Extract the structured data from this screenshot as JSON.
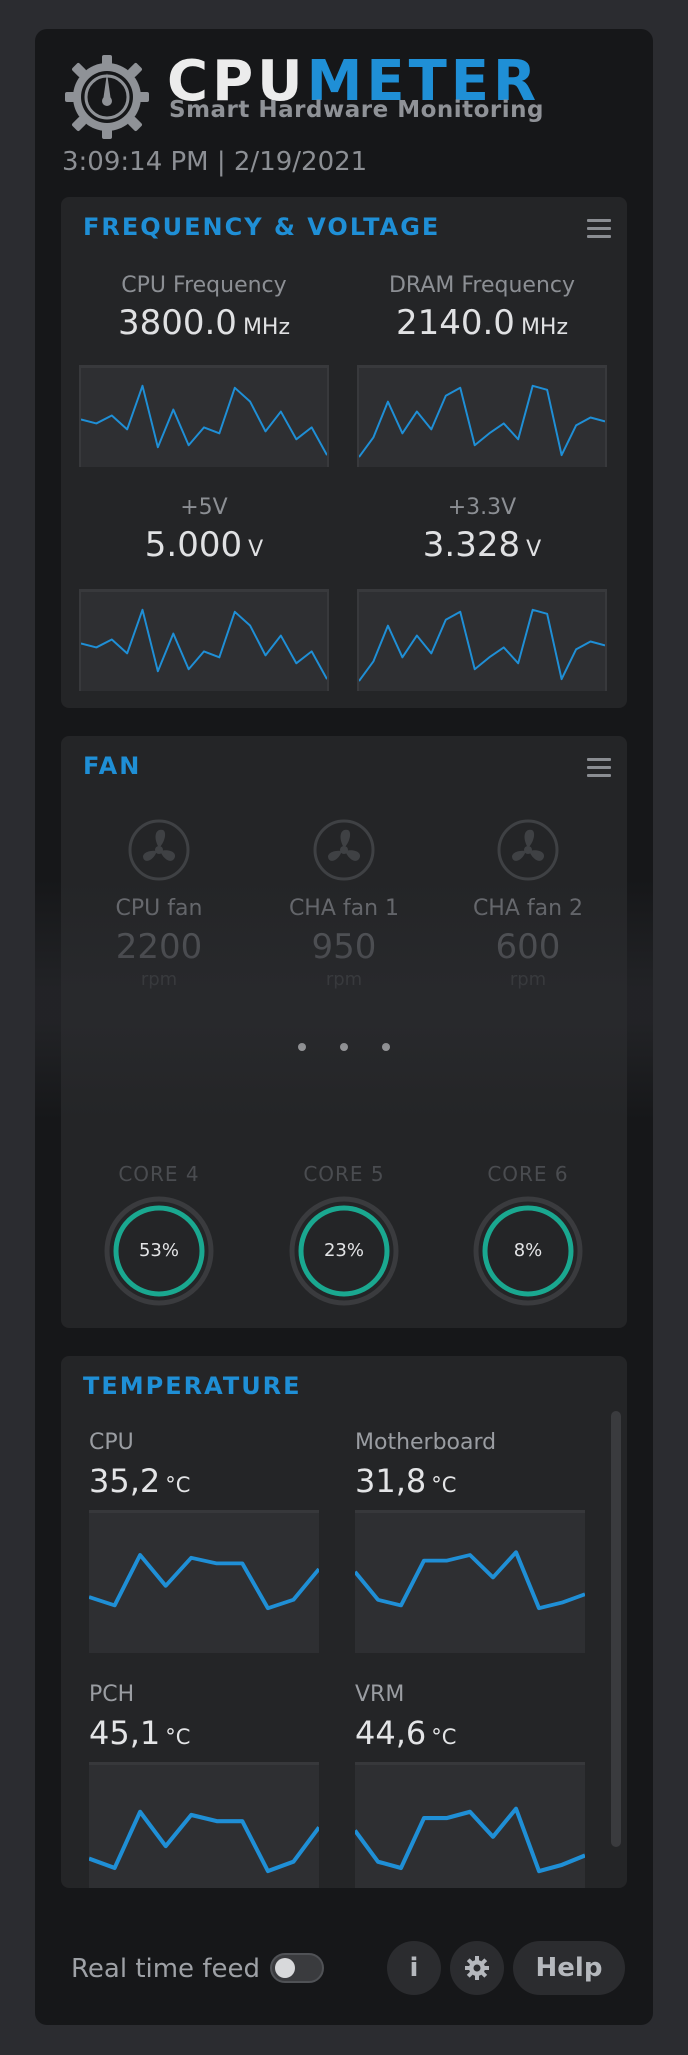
{
  "header": {
    "brand_part1": "CPU",
    "brand_part2": "METER",
    "subtitle": "Smart Hardware Monitoring",
    "datetime": "3:09:14 PM | 2/19/2021",
    "logo_icon": "gauge-gear-icon"
  },
  "colors": {
    "accent": "#1f8fd6",
    "teal_ring": "#1aa890",
    "panel_bg": "#242527",
    "app_bg": "#161719"
  },
  "frequency_voltage": {
    "title": "FREQUENCY & VOLTAGE",
    "metrics": [
      {
        "label": "CPU Frequency",
        "value": "3800.0",
        "unit": "MHz"
      },
      {
        "label": "DRAM Frequency",
        "value": "2140.0",
        "unit": "MHz"
      },
      {
        "label": "+5V",
        "value": "5.000",
        "unit": "V"
      },
      {
        "label": "+3.3V",
        "value": "3.328",
        "unit": "V"
      }
    ],
    "sparkline_a": [
      0.52,
      0.56,
      0.48,
      0.62,
      0.18,
      0.8,
      0.42,
      0.78,
      0.6,
      0.66,
      0.2,
      0.34,
      0.64,
      0.44,
      0.72,
      0.6,
      0.88
    ],
    "sparkline_b": [
      0.9,
      0.7,
      0.34,
      0.66,
      0.44,
      0.62,
      0.28,
      0.2,
      0.78,
      0.66,
      0.56,
      0.72,
      0.18,
      0.22,
      0.88,
      0.58,
      0.5,
      0.54
    ]
  },
  "fan": {
    "title": "FAN",
    "fans": [
      {
        "label": "CPU fan",
        "value": "2200",
        "unit": "rpm"
      },
      {
        "label": "CHA fan 1",
        "value": "950",
        "unit": "rpm"
      },
      {
        "label": "CHA fan 2",
        "value": "600",
        "unit": "rpm"
      }
    ],
    "cores": [
      {
        "label": "CORE 4",
        "percent": 53,
        "text": "53%"
      },
      {
        "label": "CORE 5",
        "percent": 23,
        "text": "23%"
      },
      {
        "label": "CORE 6",
        "percent": 8,
        "text": "8%"
      }
    ]
  },
  "temperature": {
    "title": "TEMPERATURE",
    "sensors": [
      {
        "label": "CPU",
        "value": "35,2",
        "unit": "°C"
      },
      {
        "label": "Motherboard",
        "value": "31,8",
        "unit": "°C"
      },
      {
        "label": "PCH",
        "value": "45,1",
        "unit": "°C"
      },
      {
        "label": "VRM",
        "value": "44,6",
        "unit": "°C"
      }
    ],
    "series_a": [
      0.6,
      0.66,
      0.3,
      0.52,
      0.32,
      0.36,
      0.36,
      0.68,
      0.62,
      0.4
    ],
    "series_b": [
      0.42,
      0.62,
      0.66,
      0.34,
      0.34,
      0.3,
      0.46,
      0.28,
      0.68,
      0.64,
      0.58
    ]
  },
  "footer": {
    "realtime_label": "Real time feed",
    "realtime_on": false,
    "info_label": "i",
    "help_label": "Help"
  }
}
